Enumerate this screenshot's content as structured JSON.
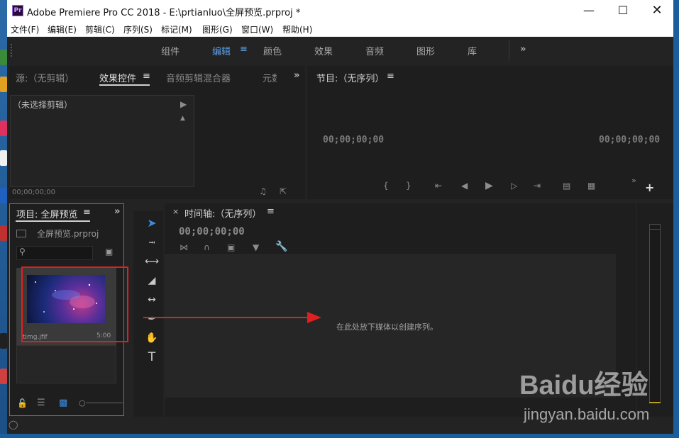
{
  "window": {
    "title": "Adobe Premiere Pro CC 2018 - E:\\prtianluo\\全屏预览.prproj *",
    "app_icon": "Pr"
  },
  "menu": [
    "文件(F)",
    "编辑(E)",
    "剪辑(C)",
    "序列(S)",
    "标记(M)",
    "图形(G)",
    "窗口(W)",
    "帮助(H)"
  ],
  "workspaces": [
    "组件",
    "编辑",
    "颜色",
    "效果",
    "音频",
    "图形",
    "库"
  ],
  "active_workspace": "编辑",
  "source_panel": {
    "tabs": [
      "源:（无剪辑）",
      "效果控件",
      "音频剪辑混合器",
      "元数"
    ],
    "no_clip": "（未选择剪辑）",
    "timecode": "00;00;00;00"
  },
  "program_panel": {
    "title": "节目:（无序列）",
    "timecode_left": "00;00;00;00",
    "timecode_right": "00;00;00;00"
  },
  "project_panel": {
    "title": "项目: 全屏预览",
    "file": "全屏预览.prproj",
    "clip_name": "timg.jfif",
    "clip_duration": "5:00"
  },
  "timeline": {
    "title": "时间轴:（无序列）",
    "timecode": "00;00;00;00",
    "drop_hint": "在此处放下媒体以创建序列。"
  },
  "colors": {
    "accent": "#5aa0e6",
    "panel_bg": "#1e1e1e",
    "frame_bg": "#232323",
    "annotation_red": "#e02020"
  },
  "watermark": {
    "brand": "Baidu经验",
    "url": "jingyan.baidu.com"
  }
}
